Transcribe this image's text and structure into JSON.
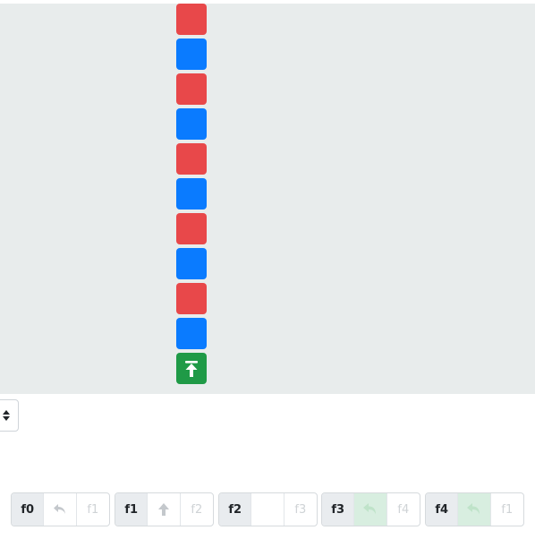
{
  "board": {
    "column": [
      "red",
      "blue",
      "red",
      "blue",
      "red",
      "blue",
      "red",
      "blue",
      "red",
      "blue"
    ],
    "start_tile": {
      "color": "green",
      "icon": "start-arrow-icon"
    },
    "colors": {
      "red": "#e8484a",
      "blue": "#0a7bff",
      "green": "#1f9a47",
      "background": "#e8ecec"
    }
  },
  "selector": {
    "icon": "sort-arrows-icon"
  },
  "functions": [
    {
      "name": "f0",
      "slot1_icon": "turn-left-icon",
      "slot2_label": "f1"
    },
    {
      "name": "f1",
      "slot1_icon": "up-arrow-icon",
      "slot2_label": "f2"
    },
    {
      "name": "f2",
      "slot1_icon": "",
      "slot2_label": "f3"
    },
    {
      "name": "f3",
      "slot1_icon": "undo-green-icon",
      "slot2_label": "f4"
    },
    {
      "name": "f4",
      "slot1_icon": "undo-green-icon",
      "slot2_label": "f1"
    }
  ]
}
